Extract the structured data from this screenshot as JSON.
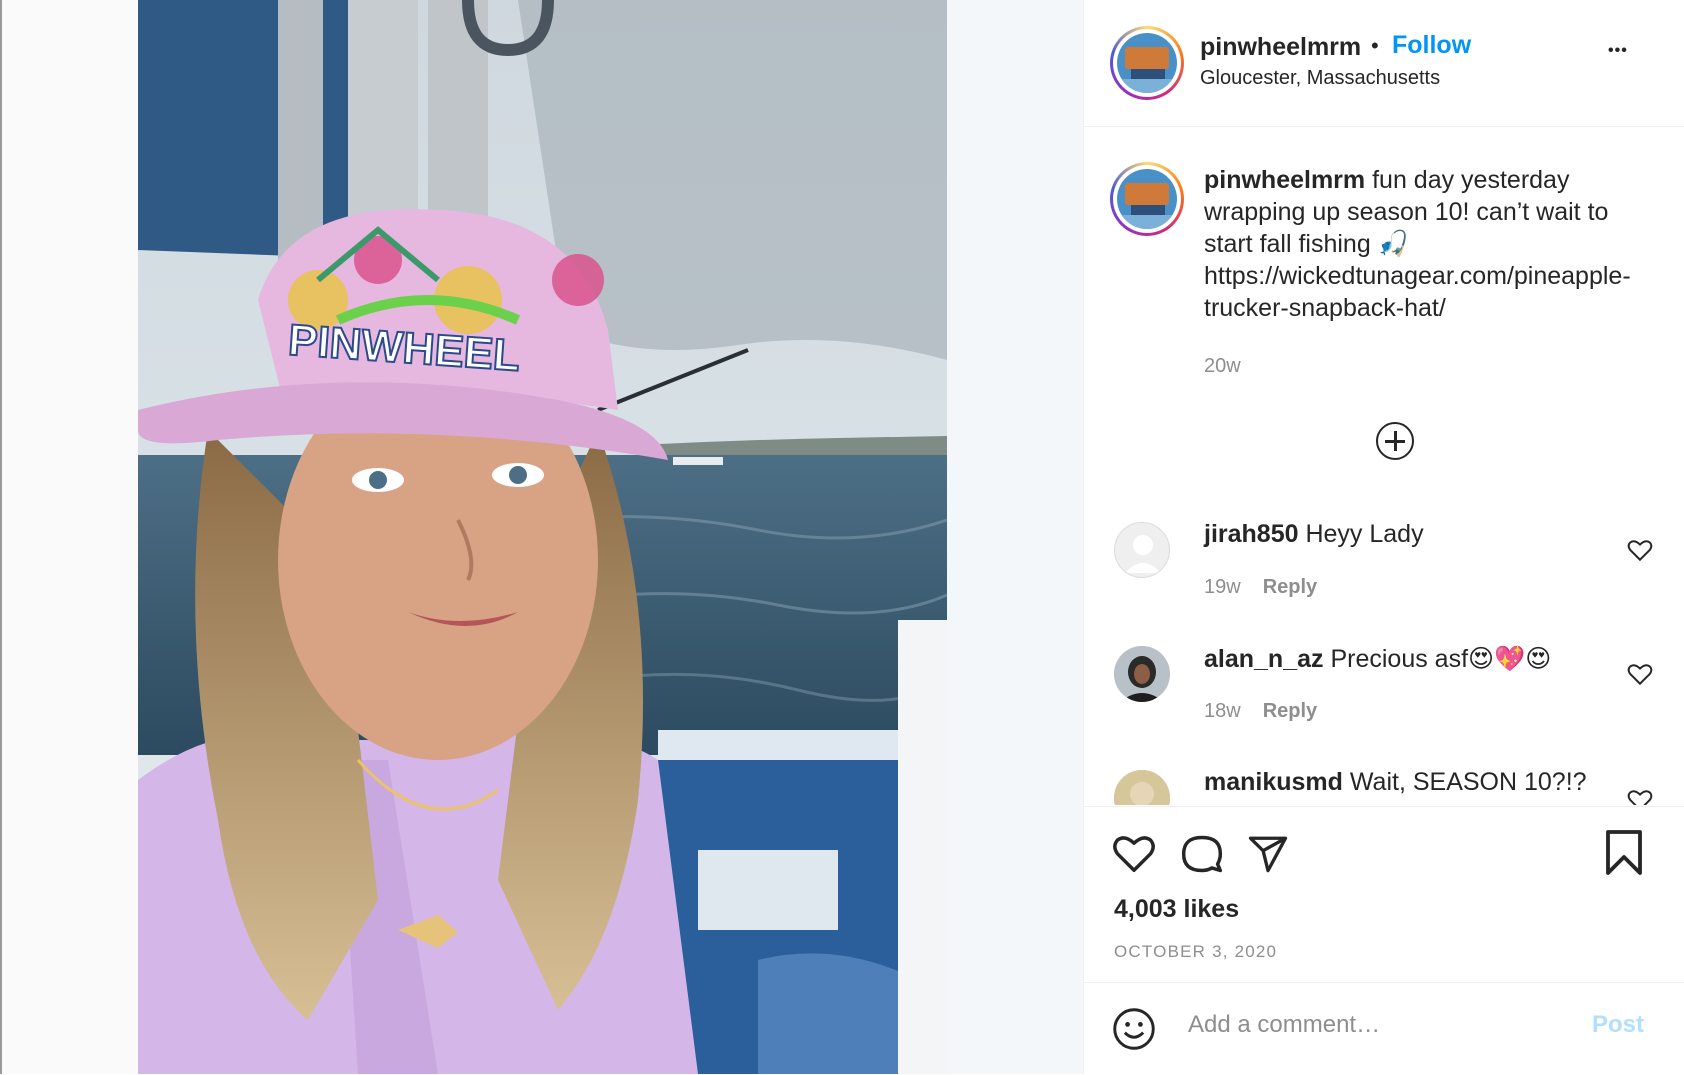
{
  "post": {
    "username": "pinwheelmrm",
    "follow_label": "Follow",
    "separator": "•",
    "location": "Gloucester, Massachusetts",
    "more_label": "•••",
    "caption_text": "fun day yesterday wrapping up season 10! can’t wait to start fall fishing 🎣 https://wickedtunagear.com/pineapple-trucker-snapback-hat/",
    "caption_time": "20w",
    "likes": "4,003 likes",
    "date": "OCTOBER 3, 2020"
  },
  "photo": {
    "hat_text": "PINWHEEL"
  },
  "comments": [
    {
      "username": "jirah850",
      "text": "Heyy Lady",
      "time": "19w",
      "reply_label": "Reply"
    },
    {
      "username": "alan_n_az",
      "text": "Precious asf😍💖😍",
      "time": "18w",
      "reply_label": "Reply"
    },
    {
      "username": "manikusmd",
      "text": "Wait, SEASON 10?!?",
      "time": "",
      "reply_label": ""
    }
  ],
  "add_comment": {
    "placeholder": "Add a comment…",
    "post_label": "Post"
  },
  "icons": {
    "like": "heart-icon",
    "comment": "comment-bubble-icon",
    "share": "paper-plane-icon",
    "save": "bookmark-icon",
    "emoji": "smiley-icon",
    "add": "plus-circle-icon"
  },
  "colors": {
    "link_blue": "#0095f6",
    "post_disabled": "#b2dffc",
    "muted": "#8e8e8e",
    "text": "#262626"
  }
}
